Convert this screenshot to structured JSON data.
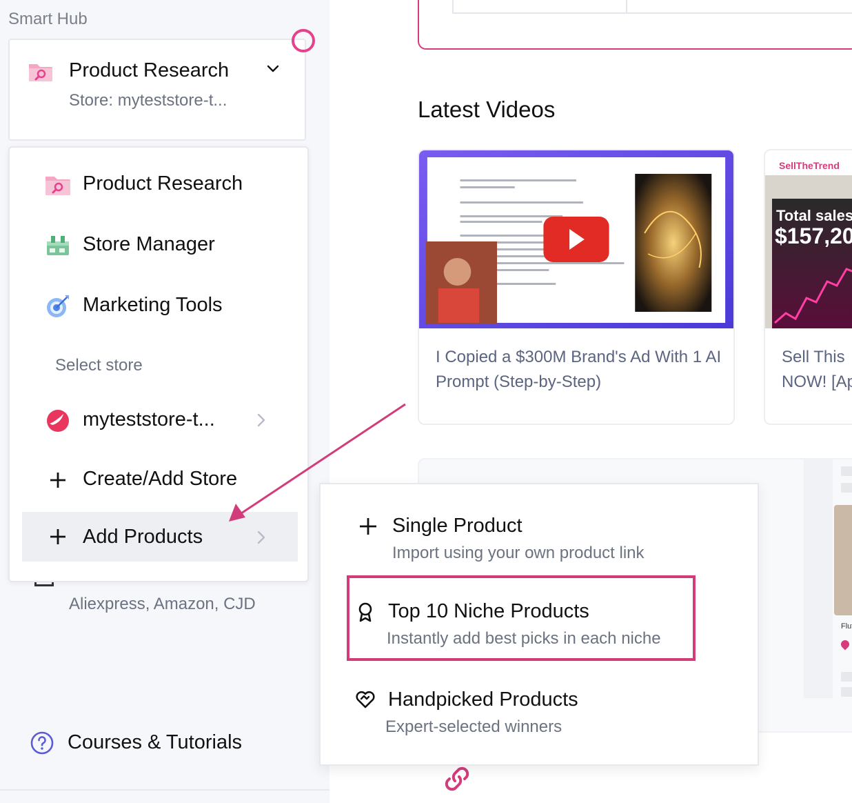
{
  "sidebar": {
    "hub_title": "Smart Hub",
    "workspace": {
      "name": "Product Research",
      "store_line": "Store: myteststore-t..."
    },
    "menu": {
      "items": [
        {
          "label": "Product Research",
          "icon": "folder-search-icon"
        },
        {
          "label": "Store Manager",
          "icon": "store-manager-icon"
        },
        {
          "label": "Marketing Tools",
          "icon": "target-icon"
        }
      ],
      "section_label": "Select store",
      "store": {
        "label": "myteststore-t...",
        "icon": "store-logo-icon"
      },
      "create_store": "Create/Add Store",
      "add_products": "Add Products"
    },
    "behind_subtitle": "Aliexpress, Amazon, CJD",
    "courses": "Courses & Tutorials"
  },
  "main": {
    "section_title": "Latest Videos",
    "videos": [
      {
        "title": "I Copied a $300M Brand's Ad With 1 AI Prompt (Step-by-Step)"
      },
      {
        "title": "Sell This NOW! [Ap",
        "thumb_brand": "SellTheTrend",
        "thumb_caption": "Total sales",
        "thumb_value": "$157,20"
      }
    ],
    "partial_text": "Flut"
  },
  "popup": {
    "items": [
      {
        "title": "Single Product",
        "subtitle": "Import using your own product link",
        "icon": "plus-icon"
      },
      {
        "title": "Top 10 Niche Products",
        "subtitle": "Instantly add best picks in each niche",
        "icon": "award-icon"
      },
      {
        "title": "Handpicked Products",
        "subtitle": "Expert-selected winners",
        "icon": "heart-handshake-icon"
      }
    ]
  },
  "colors": {
    "accent": "#d33c7b",
    "text": "#111111",
    "muted": "#6b7280"
  }
}
